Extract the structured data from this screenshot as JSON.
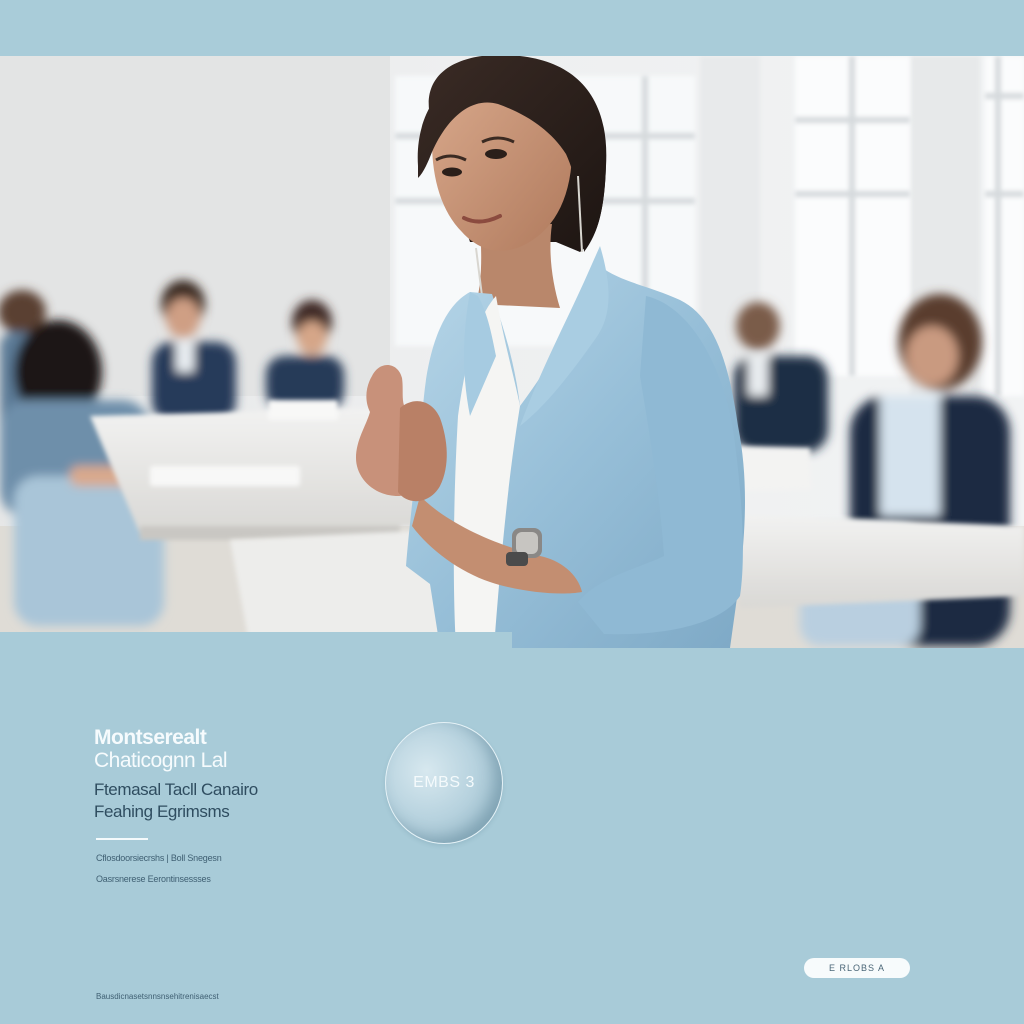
{
  "hero": {
    "alt": "Businesswoman in a light blue blazer speaking in a bright meeting room"
  },
  "title": {
    "line1": "Montserealt",
    "line2": "Chaticognn Lal",
    "sub1": "Ftemasal Tacll Canairo",
    "sub2": "Feahing Egrimsms"
  },
  "meta": {
    "line1": "Cflosdoorsiecrshs | Boll Snegesn",
    "line2": "Oasrsnerese   Eerontinsessses"
  },
  "badge": {
    "label": "EMBS 3"
  },
  "cta": {
    "label": "E RLOBS A"
  },
  "footer": {
    "note": "Bausdicnasetsnnsnsehitrenisaecst"
  },
  "colors": {
    "background": "#a8cbd8",
    "blazer": "#9cc4dc",
    "title_text": "#f6fbfd",
    "subtitle_text": "#2f4d60"
  }
}
